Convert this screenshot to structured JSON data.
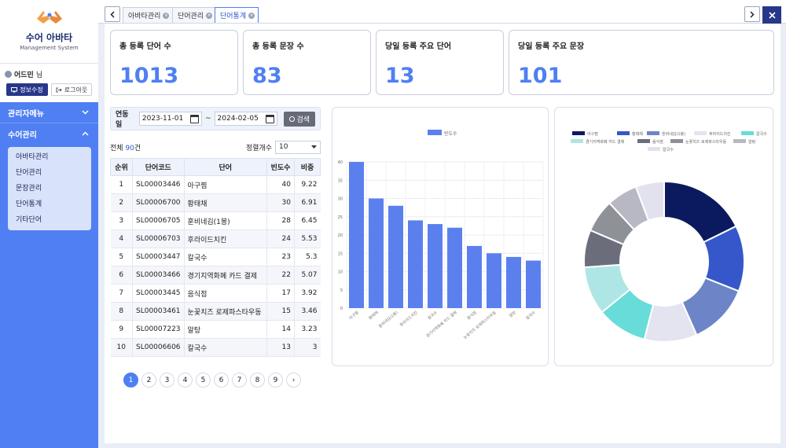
{
  "brand": {
    "title": "수어 아바타",
    "subtitle": "Management System"
  },
  "user": {
    "name": "어드민",
    "suffix": "님",
    "info_btn": "정보수정",
    "logout_btn": "로그아웃"
  },
  "nav": {
    "admin_menu": "관리자메뉴",
    "sign_menu": "수어관리",
    "sub_items": [
      "아바타관리",
      "단어관리",
      "문장관리",
      "단어통계",
      "기타단어"
    ]
  },
  "tabs": [
    {
      "label": "아바타관리",
      "active": false
    },
    {
      "label": "단어관리",
      "active": false
    },
    {
      "label": "단어통계",
      "active": true
    }
  ],
  "cards": [
    {
      "title": "총 등록 단어 수",
      "value": "1013"
    },
    {
      "title": "총 등록 문장 수",
      "value": "83"
    },
    {
      "title": "당일 등록 주요 단어",
      "value": "13"
    },
    {
      "title": "당일 등록 주요 문장",
      "value": "101"
    }
  ],
  "search": {
    "label": "연동일",
    "from": "2023-11-01",
    "tilde": "~",
    "to": "2024-02-05",
    "button": "검색"
  },
  "summary": {
    "prefix": "전체 ",
    "count": "90",
    "suffix": "건",
    "sort_label": "정렬개수",
    "sort_value": "10"
  },
  "table": {
    "headers": [
      "순위",
      "단어코드",
      "단어",
      "빈도수",
      "비중"
    ],
    "rows": [
      [
        "1",
        "SL00003446",
        "아구찜",
        "40",
        "9.22"
      ],
      [
        "2",
        "SL00006700",
        "황태채",
        "30",
        "6.91"
      ],
      [
        "3",
        "SL00006705",
        "훈비네김(1봉)",
        "28",
        "6.45"
      ],
      [
        "4",
        "SL00006703",
        "후라이드치킨",
        "24",
        "5.53"
      ],
      [
        "5",
        "SL00003447",
        "칼국수",
        "23",
        "5.3"
      ],
      [
        "6",
        "SL00003466",
        "경기지역화폐 카드 결제",
        "22",
        "5.07"
      ],
      [
        "7",
        "SL00003445",
        "음식점",
        "17",
        "3.92"
      ],
      [
        "8",
        "SL00003461",
        "눈꽃치즈 로제파스타우동",
        "15",
        "3.46"
      ],
      [
        "9",
        "SL00007223",
        "알탕",
        "14",
        "3.23"
      ],
      [
        "10",
        "SL00006606",
        "칼국수",
        "13",
        "3"
      ]
    ]
  },
  "pager": {
    "pages": [
      "1",
      "2",
      "3",
      "4",
      "5",
      "6",
      "7",
      "8",
      "9"
    ],
    "active": "1",
    "next": "›"
  },
  "chart_data": [
    {
      "type": "bar",
      "legend": "빈도수",
      "categories": [
        "아구찜",
        "황태채",
        "훈비네김(1봉)",
        "후라이드치킨",
        "칼국수",
        "경기지역화폐 카드 결제",
        "음식점",
        "눈꽃치즈 로제파스타우동",
        "알탕",
        "칼국수"
      ],
      "values": [
        40,
        30,
        28,
        24,
        23,
        22,
        17,
        15,
        14,
        13
      ],
      "ylim": [
        0,
        40
      ],
      "yticks": [
        "0",
        "5",
        "10",
        "15",
        "20",
        "25",
        "30",
        "35",
        "40"
      ],
      "color": "#5b80ee"
    },
    {
      "type": "pie",
      "donut": true,
      "labels": [
        "아구찜",
        "황태채",
        "훈비네김(1봉)",
        "후라이드치킨",
        "칼국수",
        "경기지역화폐 카드 결제",
        "음식점",
        "눈꽃치즈 로제파스타우동",
        "알탕",
        "칼국수"
      ],
      "values": [
        40,
        30,
        28,
        24,
        23,
        22,
        17,
        15,
        14,
        13
      ],
      "colors": [
        "#0b1a5e",
        "#3557c9",
        "#6d85c7",
        "#e3e4ef",
        "#67dcd9",
        "#aee6e5",
        "#6b6e7a",
        "#8f9198",
        "#b8b8c4",
        "#e2e1ee"
      ]
    }
  ]
}
